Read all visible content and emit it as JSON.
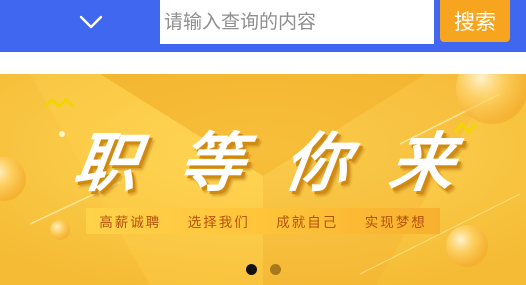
{
  "header": {
    "background_color": "#3f67ef",
    "dropdown_icon": "chevron-down-icon",
    "search": {
      "placeholder": "请输入查询的内容",
      "value": ""
    },
    "search_button_label": "搜索",
    "search_button_color": "#f7a51f"
  },
  "banner": {
    "headline_chars": [
      "职",
      "等",
      "你",
      "来"
    ],
    "tagline_items": [
      "高薪诚聘",
      "选择我们",
      "成就自己",
      "实现梦想"
    ],
    "background_color": "#f6c23e",
    "carousel": {
      "total": 2,
      "active_index": 0
    }
  }
}
